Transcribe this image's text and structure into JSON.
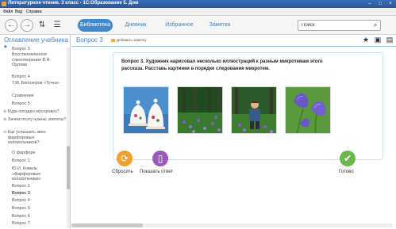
{
  "window": {
    "title": "Литературное чтение. 3 класс - 1С:Образование 5. Дом"
  },
  "menu": {
    "items": [
      "Файл",
      "Вид",
      "Справка"
    ]
  },
  "toolbar": {
    "tabs": [
      {
        "label": "Библиотека",
        "active": true
      },
      {
        "label": "Дневник",
        "active": false
      },
      {
        "label": "Избранное",
        "active": false
      },
      {
        "label": "Заметки",
        "active": false
      }
    ],
    "search_placeholder": "Поиск",
    "search_value": "Поиск"
  },
  "sidebar": {
    "title": "Оглавление учебника",
    "items": [
      {
        "label": "Вопрос 3"
      },
      {
        "label": "Восстановленное стихотворение В.Н. Орлова"
      },
      {
        "label": "Вопрос 4"
      },
      {
        "label": "Т.М. Белозеров «Тучка»"
      },
      {
        "label": "Сравнение"
      },
      {
        "label": "Вопрос 5"
      },
      {
        "label": "Куда опоздал мусоровоз?"
      },
      {
        "label": "Зачем поэту нужны эпитеты?"
      },
      {
        "label": "Как услышать звон фарфоровых колокольчиков?"
      },
      {
        "label": "О фарфоре"
      },
      {
        "label": "Вопрос 1"
      },
      {
        "label": "Ю.И. Коваль «Фарфоровые колокольчики»"
      },
      {
        "label": "Вопрос 2"
      },
      {
        "label": "Вопрос 3",
        "current": true
      },
      {
        "label": "Вопрос 4"
      },
      {
        "label": "Вопрос 5"
      },
      {
        "label": "Вопрос 6"
      },
      {
        "label": "Вопрос 7"
      }
    ]
  },
  "main": {
    "question_title": "Вопрос 3",
    "add_note": "Добавить заметку",
    "task_text": "Вопрос 3. Художник нарисовал несколько иллюстраций к разным микротемам этого рассказа. Расставь картинки в порядке следования микротем.",
    "pictures": [
      "porcelain-bells",
      "forest-flowers",
      "boy-in-forest",
      "bellflowers"
    ]
  },
  "actions": {
    "reset": "Сбросить",
    "show_answer": "Показать ответ",
    "done": "Готово"
  },
  "colors": {
    "accent": "#3d8ad3",
    "reset": "#f0a030",
    "show_answer": "#9a5ab8",
    "done": "#6ab84a"
  }
}
